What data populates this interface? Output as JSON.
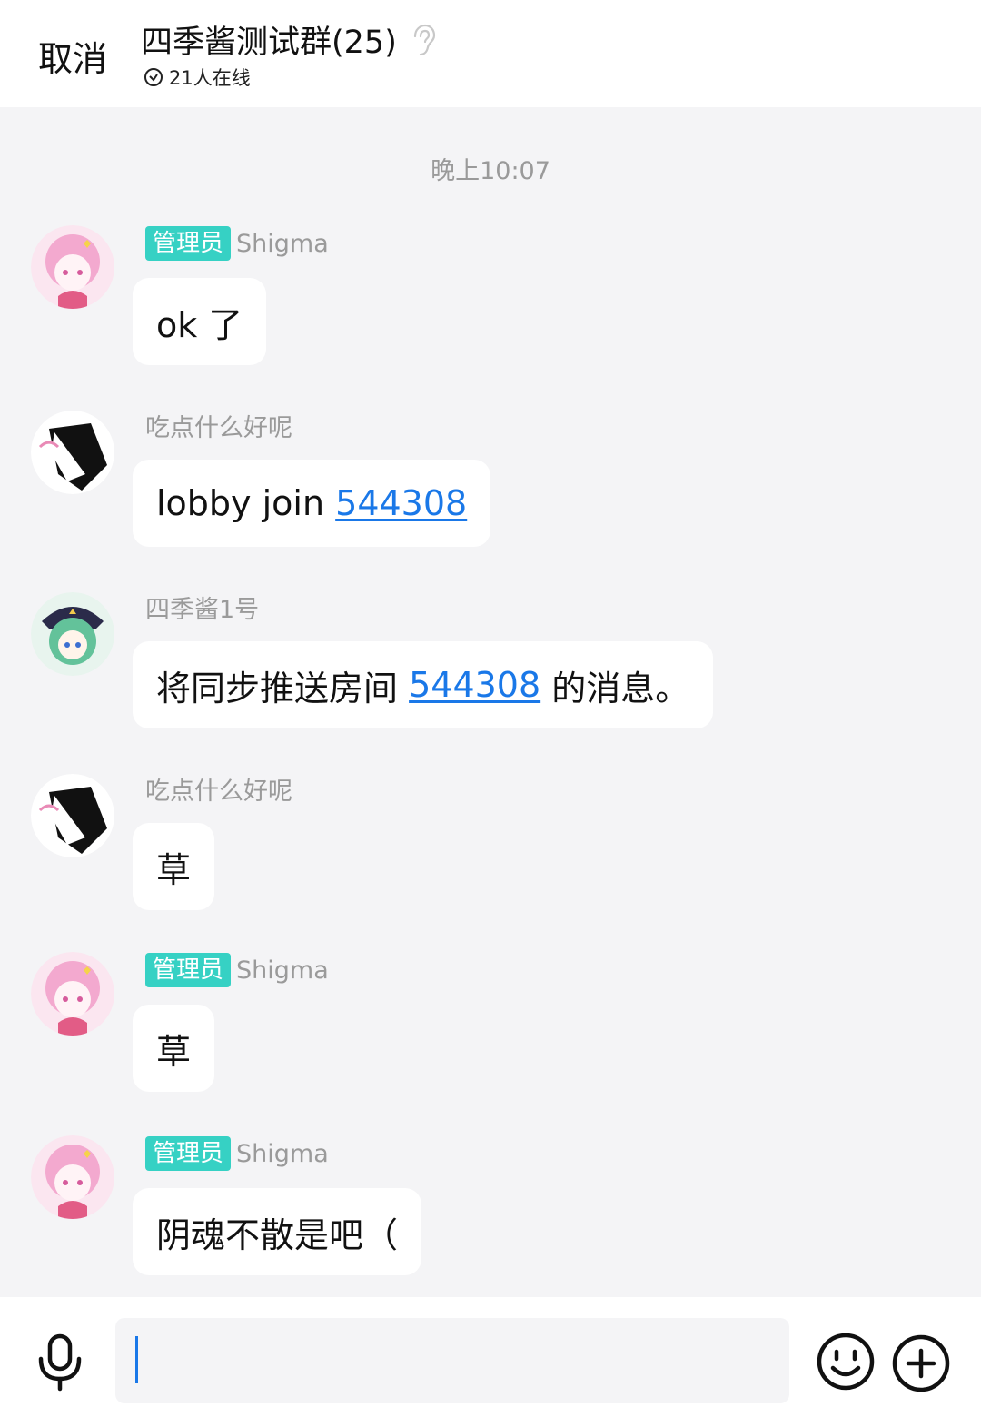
{
  "header": {
    "cancel_label": "取消",
    "title": "四季酱测试群(25)",
    "online": "21人在线"
  },
  "chat": {
    "timestamp": "晚上10:07",
    "messages": [
      {
        "sender": "Shigma",
        "badge": "管理员",
        "text": "ok 了",
        "avatar": "pink-hair-girl-avatar"
      },
      {
        "sender": "吃点什么好呢",
        "badge": "",
        "text": "lobby join ",
        "link": "544308",
        "avatar": "black-white-sketch-avatar"
      },
      {
        "sender": "四季酱1号",
        "badge": "",
        "text": "将同步推送房间 ",
        "link": "544308",
        "suffix": " 的消息。",
        "avatar": "green-hair-girl-avatar"
      },
      {
        "sender": "吃点什么好呢",
        "badge": "",
        "text": "草",
        "avatar": "black-white-sketch-avatar"
      },
      {
        "sender": "Shigma",
        "badge": "管理员",
        "text": "草",
        "avatar": "pink-hair-girl-avatar"
      },
      {
        "sender": "Shigma",
        "badge": "管理员",
        "text": "阴魂不散是吧（",
        "avatar": "pink-hair-girl-avatar"
      }
    ]
  },
  "input": {
    "value": "",
    "icons": [
      "microphone-icon",
      "emoji-icon",
      "plus-icon"
    ]
  },
  "colors": {
    "accent": "#1a78e8",
    "badge": "#36d1c4",
    "background": "#f4f4f6"
  }
}
